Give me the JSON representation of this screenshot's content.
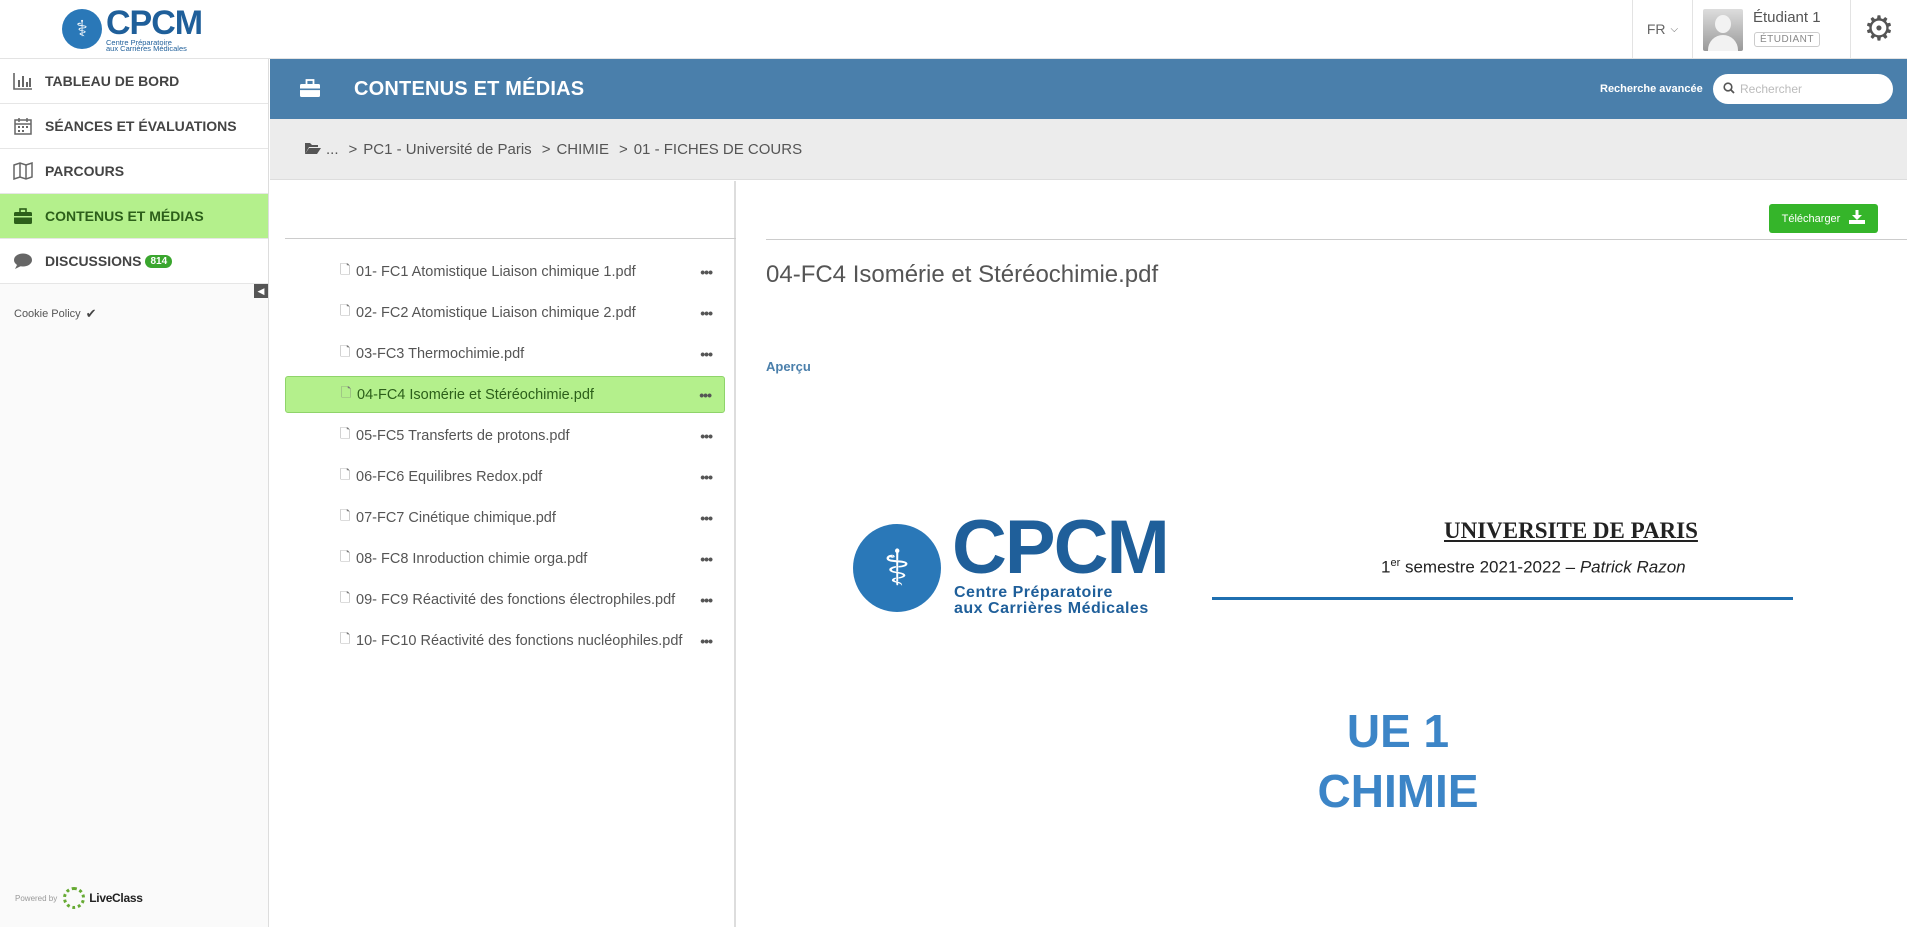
{
  "brand": {
    "logo_text": "CPCM",
    "logo_subtitle_line1": "Centre Préparatoire",
    "logo_subtitle_line2": "aux Carrières Médicales"
  },
  "topbar": {
    "language": "FR",
    "user_name": "Étudiant 1",
    "user_role": "ÉTUDIANT",
    "settings_icon": "gear-icon"
  },
  "sidebar": {
    "items": [
      {
        "label": "TABLEAU DE BORD",
        "icon": "bar-chart-icon",
        "active": false
      },
      {
        "label": "SÉANCES ET ÉVALUATIONS",
        "icon": "calendar-icon",
        "active": false
      },
      {
        "label": "PARCOURS",
        "icon": "map-icon",
        "active": false
      },
      {
        "label": "CONTENUS ET MÉDIAS",
        "icon": "briefcase-icon",
        "active": true
      },
      {
        "label": "DISCUSSIONS",
        "icon": "chat-icon",
        "active": false,
        "badge": "814"
      }
    ],
    "cookie_policy": "Cookie Policy",
    "powered_by": "Powered by",
    "powered_brand": "LiveClass"
  },
  "header": {
    "title": "CONTENUS ET MÉDIAS",
    "advanced_search": "Recherche avancée",
    "search_placeholder": "Rechercher",
    "color": "#4a7fab"
  },
  "breadcrumb": {
    "root": "...",
    "items": [
      "PC1 - Université de Paris",
      "CHIMIE",
      "01 - FICHES DE COURS"
    ]
  },
  "files": [
    {
      "name": "01- FC1 Atomistique Liaison chimique 1.pdf",
      "selected": false
    },
    {
      "name": "02- FC2 Atomistique Liaison chimique 2.pdf",
      "selected": false
    },
    {
      "name": "03-FC3 Thermochimie.pdf",
      "selected": false
    },
    {
      "name": "04-FC4 Isomérie et Stéréochimie.pdf",
      "selected": true
    },
    {
      "name": "05-FC5 Transferts de protons.pdf",
      "selected": false
    },
    {
      "name": "06-FC6 Equilibres Redox.pdf",
      "selected": false
    },
    {
      "name": "07-FC7 Cinétique chimique.pdf",
      "selected": false
    },
    {
      "name": "08- FC8 Inroduction chimie orga.pdf",
      "selected": false
    },
    {
      "name": "09- FC9 Réactivité des fonctions électrophiles.pdf",
      "selected": false
    },
    {
      "name": "10- FC10 Réactivité des fonctions nucléophiles.pdf",
      "selected": false
    }
  ],
  "preview": {
    "download_label": "Télécharger",
    "title": "04-FC4 Isomérie et Stéréochimie.pdf",
    "apercu_label": "Aperçu",
    "doc": {
      "logo_text": "CPCM",
      "logo_sub1": "Centre Préparatoire",
      "logo_sub2": "aux Carrières Médicales",
      "university": "UNIVERSITE DE PARIS",
      "semester_pre": "1",
      "semester_sup": "er",
      "semester_mid": " semestre 2021-2022 – ",
      "semester_author": "Patrick Razon",
      "ue_line1": "UE 1",
      "ue_line2": "CHIMIE"
    }
  },
  "colors": {
    "active_green": "#b4f08c",
    "download_green": "#35b52a",
    "badge_green": "#3aa62e",
    "header_blue": "#4a7fab"
  }
}
